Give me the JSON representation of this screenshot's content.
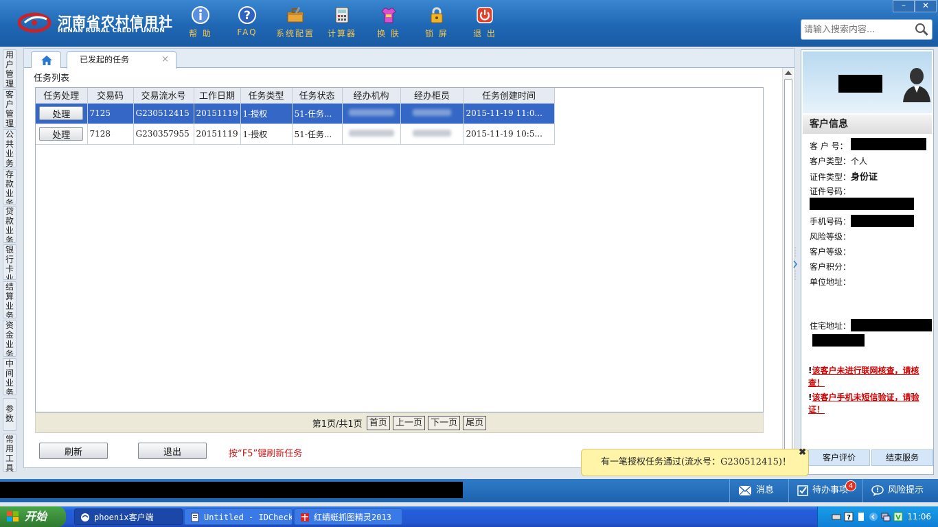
{
  "header": {
    "logo_cn": "河南省农村信用社",
    "logo_en": "HENAN RURAL CREDIT UNION",
    "tools": [
      {
        "label": "帮 助",
        "icon": "info-icon"
      },
      {
        "label": "FAQ",
        "icon": "question-icon"
      },
      {
        "label": "系统配置",
        "icon": "toolbox-icon"
      },
      {
        "label": "计算器",
        "icon": "calculator-icon"
      },
      {
        "label": "换 肤",
        "icon": "shirt-icon"
      },
      {
        "label": "锁 屏",
        "icon": "lock-icon"
      },
      {
        "label": "退 出",
        "icon": "power-icon"
      }
    ],
    "window_buttons": {
      "minimize": "–",
      "close": "✕"
    },
    "search": {
      "placeholder": "请输入搜索内容..."
    }
  },
  "left_nav": [
    {
      "label": "用户管理"
    },
    {
      "label": "客户管理"
    },
    {
      "label": "公共业务"
    },
    {
      "label": "存款业务"
    },
    {
      "label": "贷款业务"
    },
    {
      "label": "银行卡业务"
    },
    {
      "label": "结算业务"
    },
    {
      "label": "资金业务"
    },
    {
      "label": "中间业务"
    },
    {
      "label": "参数"
    },
    {
      "label": "常用工具"
    }
  ],
  "tabs": {
    "active_label": "已发起的任务",
    "close": "×"
  },
  "main": {
    "section_title": "任务列表",
    "columns": [
      "任务处理",
      "交易码",
      "交易流水号",
      "工作日期",
      "任务类型",
      "任务状态",
      "经办机构",
      "经办柜员",
      "任务创建时间"
    ],
    "rows": [
      {
        "action": "处理",
        "code": "7125",
        "serial": "G230512415",
        "date": "20151119",
        "type": "1-授权",
        "status": "51-任务...",
        "created": "2015-11-19 11:0...",
        "selected": true
      },
      {
        "action": "处理",
        "code": "7128",
        "serial": "G230357955",
        "date": "20151119",
        "type": "1-授权",
        "status": "51-任务...",
        "created": "2015-11-19 10:5...",
        "selected": false
      }
    ],
    "pager": {
      "info": "第1页/共1页",
      "first": "首页",
      "prev": "上一页",
      "next": "下一页",
      "last": "尾页"
    },
    "refresh_label": "刷新",
    "exit_label": "退出",
    "hint": "按“F5”键刷新任务"
  },
  "customer_panel": {
    "title": "客户信息",
    "fields": {
      "customer_no_label": "客 户 号：",
      "customer_type_label": "客户类型：",
      "customer_type_value": "个人",
      "id_type_label": "证件类型：",
      "id_type_value": "身份证",
      "id_no_label": "证件号码：",
      "phone_label": "手机号码：",
      "risk_label": "风险等级：",
      "level_label": "客户等级：",
      "points_label": "客户积分：",
      "work_addr_label": "单位地址：",
      "home_addr_label": "住宅地址："
    },
    "warnings": [
      "该客户未进行联网核查，请核查！",
      "该客户手机未短信验证，请验证！"
    ],
    "rate_button": "客户评价",
    "end_button": "结束服务"
  },
  "toast": {
    "message": "有一笔授权任务通过(流水号：G230512415)！",
    "close": "✖"
  },
  "statusbar": {
    "messages_label": "消息",
    "todo_label": "待办事项",
    "todo_count": "4",
    "risk_label": "风险提示"
  },
  "taskbar": {
    "start_label": "开始",
    "tasks": [
      {
        "label": "phoenix客户端",
        "active": true
      },
      {
        "label": "Untitled - IDCheck",
        "active": false
      },
      {
        "label": "红蜻蜓抓图精灵2013",
        "active": false
      }
    ],
    "clock": "11:06"
  },
  "colors": {
    "header_blue": "#1f67b4",
    "tool_label": "#f3c64e",
    "selected_row": "#3568c6",
    "warning_red": "#cc0000",
    "toast_bg": "#fff4a8"
  }
}
